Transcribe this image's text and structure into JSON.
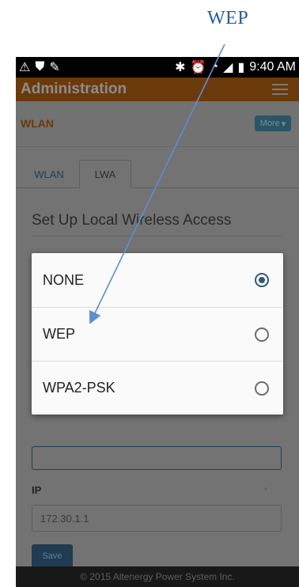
{
  "annotation": {
    "label": "WEP"
  },
  "statusbar": {
    "time": "9:40 AM"
  },
  "appbar": {
    "title": "Administration"
  },
  "subbar": {
    "title": "WLAN",
    "more_label": "More"
  },
  "tabs": [
    {
      "label": "WLAN"
    },
    {
      "label": "LWA"
    }
  ],
  "main": {
    "heading": "Set Up Local Wireless Access",
    "ip_label": "IP",
    "ip_value": "172.30.1.1",
    "save_label": "Save"
  },
  "dialog": {
    "options": [
      {
        "label": "NONE",
        "selected": true
      },
      {
        "label": "WEP",
        "selected": false
      },
      {
        "label": "WPA2-PSK",
        "selected": false
      }
    ]
  },
  "footer": {
    "text": "© 2015 Altenergy Power System Inc."
  },
  "colors": {
    "accent": "#2c5a7a",
    "brand": "#6b3a0b",
    "annotation": "#1f5fa8"
  }
}
